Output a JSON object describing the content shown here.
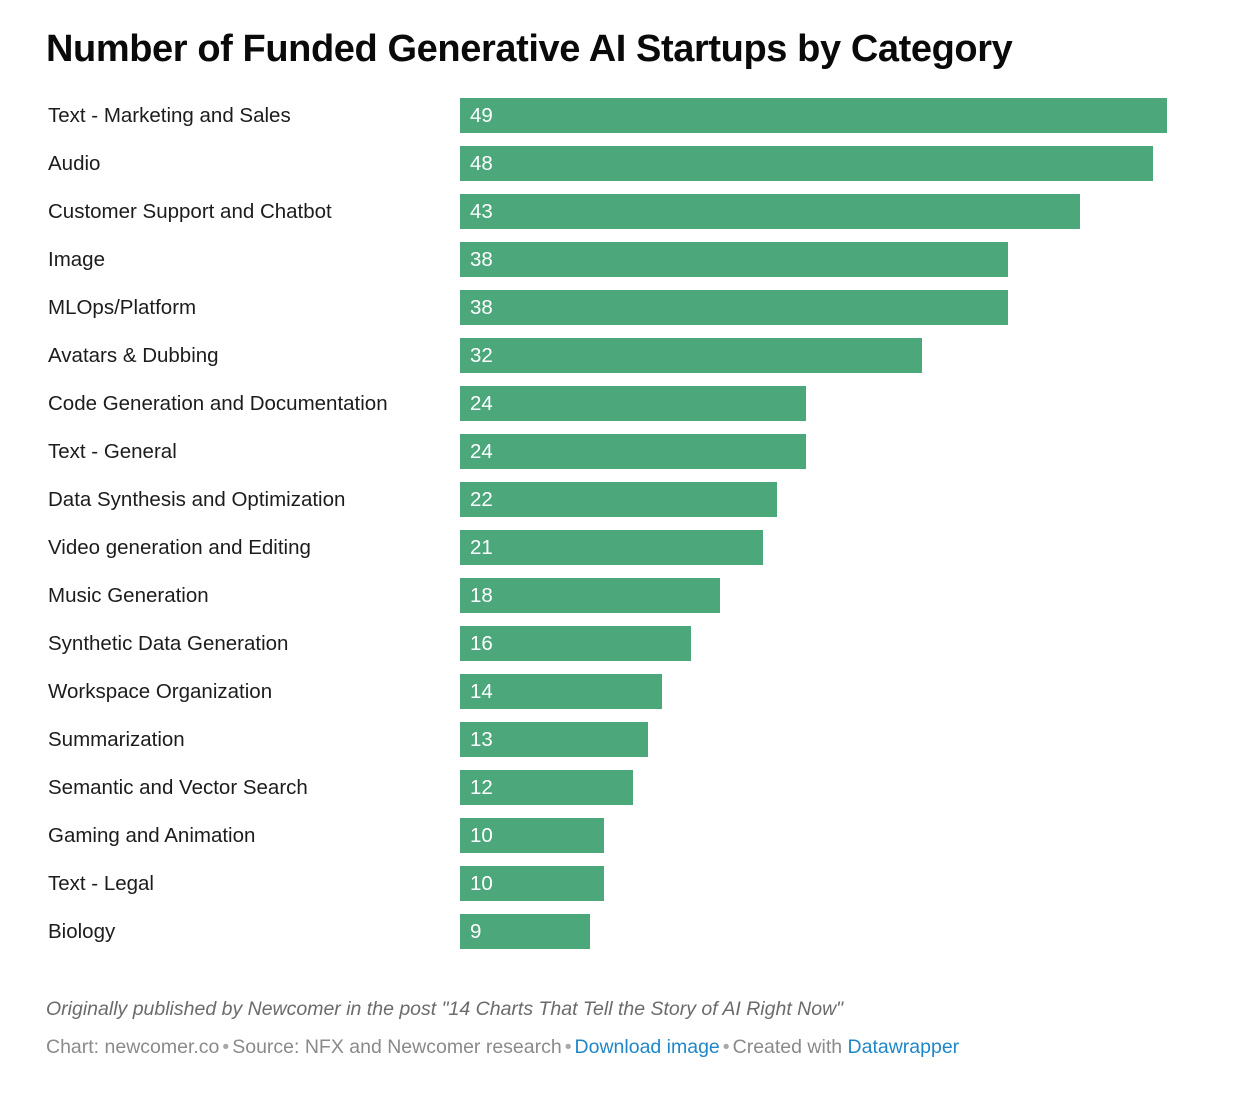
{
  "title": "Number of Funded Generative AI Startups by Category",
  "colors": {
    "bar": "#4CA87B",
    "bar_value_text": "#ffffff",
    "category_text": "#1c1c1c",
    "title_text": "#0a0a0a",
    "link": "#1F87C8",
    "credit_text": "#8a8a8a",
    "footnote_text": "#6b6b6b",
    "background": "#ffffff"
  },
  "footnote": "Originally published by Newcomer in the post \"14 Charts That Tell the Story of AI Right Now\"",
  "credits": {
    "chart_label": "Chart: newcomer.co",
    "sep1": "•",
    "source_label": "Source: NFX and Newcomer research",
    "sep2": "•",
    "download_link": "Download image",
    "sep3": "•",
    "created_with_label": "Created with",
    "datawrapper_link": "Datawrapper"
  },
  "chart_data": {
    "type": "bar",
    "orientation": "horizontal",
    "title": "Number of Funded Generative AI Startups by Category",
    "xlabel": "",
    "ylabel": "",
    "xlim": [
      0,
      49
    ],
    "grid": false,
    "legend": false,
    "value_labels": true,
    "categories": [
      "Text - Marketing and Sales",
      "Audio",
      "Customer Support and Chatbot",
      "Image",
      "MLOps/Platform",
      "Avatars & Dubbing",
      "Code Generation and Documentation",
      "Text - General",
      "Data Synthesis and Optimization",
      "Video generation and Editing",
      "Music Generation",
      "Synthetic Data Generation",
      "Workspace Organization",
      "Summarization",
      "Semantic and Vector Search",
      "Gaming and Animation",
      "Text - Legal",
      "Biology"
    ],
    "values": [
      49,
      48,
      43,
      38,
      38,
      32,
      24,
      24,
      22,
      21,
      18,
      16,
      14,
      13,
      12,
      10,
      10,
      9
    ],
    "bars": [
      {
        "category": "Text - Marketing and Sales",
        "value": 49,
        "label": "49"
      },
      {
        "category": "Audio",
        "value": 48,
        "label": "48"
      },
      {
        "category": "Customer Support and Chatbot",
        "value": 43,
        "label": "43"
      },
      {
        "category": "Image",
        "value": 38,
        "label": "38"
      },
      {
        "category": "MLOps/Platform",
        "value": 38,
        "label": "38"
      },
      {
        "category": "Avatars & Dubbing",
        "value": 32,
        "label": "32"
      },
      {
        "category": "Code Generation and Documentation",
        "value": 24,
        "label": "24"
      },
      {
        "category": "Text - General",
        "value": 24,
        "label": "24"
      },
      {
        "category": "Data Synthesis and Optimization",
        "value": 22,
        "label": "22"
      },
      {
        "category": "Video generation and Editing",
        "value": 21,
        "label": "21"
      },
      {
        "category": "Music Generation",
        "value": 18,
        "label": "18"
      },
      {
        "category": "Synthetic Data Generation",
        "value": 16,
        "label": "16"
      },
      {
        "category": "Workspace Organization",
        "value": 14,
        "label": "14"
      },
      {
        "category": "Summarization",
        "value": 13,
        "label": "13"
      },
      {
        "category": "Semantic and Vector Search",
        "value": 12,
        "label": "12"
      },
      {
        "category": "Gaming and Animation",
        "value": 10,
        "label": "10"
      },
      {
        "category": "Text - Legal",
        "value": 10,
        "label": "10"
      },
      {
        "category": "Biology",
        "value": 9,
        "label": "9"
      }
    ]
  }
}
